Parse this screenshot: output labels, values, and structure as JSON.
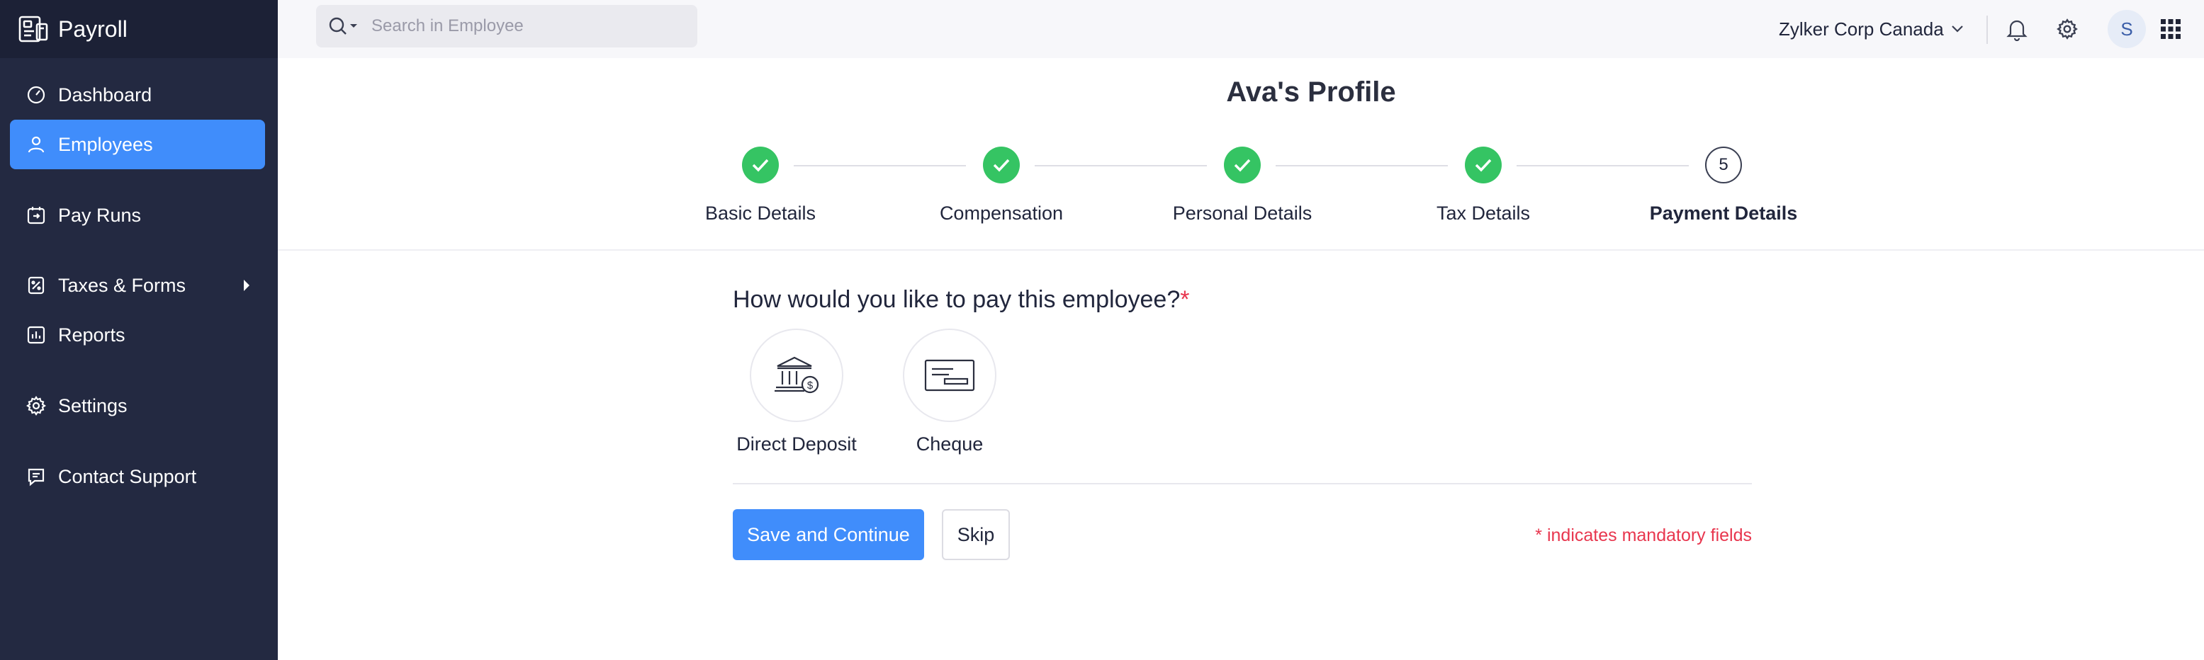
{
  "app": {
    "name": "Payroll"
  },
  "sidebar": {
    "items": [
      {
        "label": "Dashboard",
        "icon": "dashboard-icon",
        "active": false
      },
      {
        "label": "Employees",
        "icon": "person-icon",
        "active": true
      },
      {
        "label": "Pay Runs",
        "icon": "pay-runs-icon",
        "active": false
      },
      {
        "label": "Taxes & Forms",
        "icon": "taxes-forms-icon",
        "active": false,
        "has_submenu": true
      },
      {
        "label": "Reports",
        "icon": "reports-icon",
        "active": false
      },
      {
        "label": "Settings",
        "icon": "gear-icon",
        "active": false
      },
      {
        "label": "Contact Support",
        "icon": "chat-icon",
        "active": false
      }
    ]
  },
  "topbar": {
    "search": {
      "placeholder": "Search in Employee",
      "value": ""
    },
    "organization": "Zylker Corp Canada",
    "avatar_initial": "S",
    "icons": [
      "search-icon",
      "bell-icon",
      "gear-icon",
      "apps-grid-icon"
    ]
  },
  "page": {
    "title": "Ava's Profile",
    "steps": [
      {
        "label": "Basic Details",
        "status": "done"
      },
      {
        "label": "Compensation",
        "status": "done"
      },
      {
        "label": "Personal Details",
        "status": "done"
      },
      {
        "label": "Tax Details",
        "status": "done"
      },
      {
        "label": "Payment Details",
        "status": "current",
        "number": "5"
      }
    ]
  },
  "form": {
    "question": "How would you like to pay this employee?",
    "required_marker": "*",
    "options": [
      {
        "label": "Direct Deposit",
        "icon": "bank-icon"
      },
      {
        "label": "Cheque",
        "icon": "cheque-icon"
      }
    ],
    "save_label": "Save and Continue",
    "skip_label": "Skip",
    "mandatory_note": "* indicates mandatory fields"
  },
  "colors": {
    "sidebar_bg": "#232941",
    "accent": "#408dfb",
    "success": "#35c463",
    "required": "#e8364e"
  }
}
